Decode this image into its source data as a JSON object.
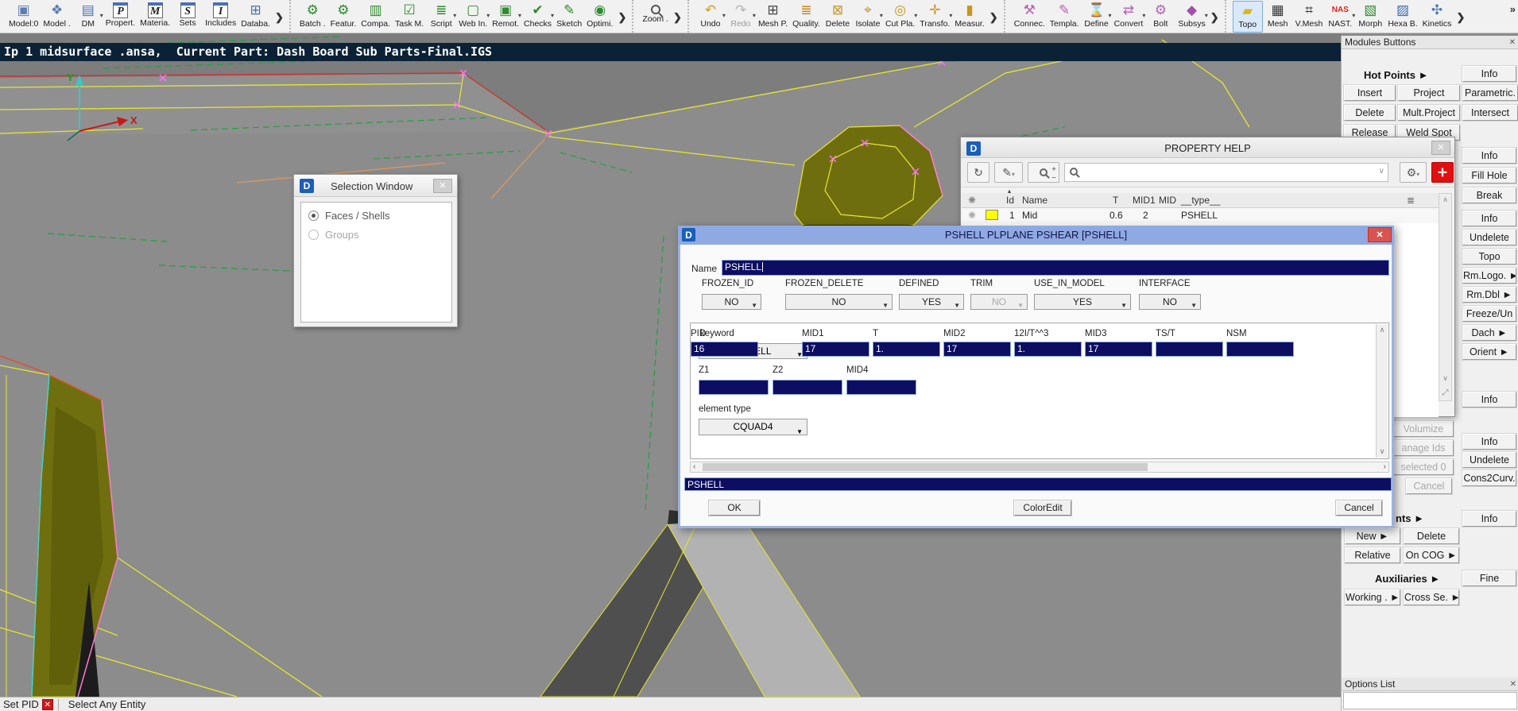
{
  "app": {
    "icon_letter": "D"
  },
  "colors": {
    "dialog_titlebar_blue": "#8fa9e3",
    "navy_field": "#0d0d62",
    "property_swatch_yellow": "#ffff00",
    "topo_active_bg": "#d9e9fb",
    "close_red": "#d9534f",
    "status_red": "#d01818",
    "viewport_gray": "#8a8a8a",
    "infobar_navy": "#0b2236"
  },
  "toolbar": {
    "overflow_chevron": "»",
    "groups": [
      {
        "items": [
          {
            "label": "Model:0",
            "icon": "▣",
            "color": "#5b7db1",
            "name": "model0"
          },
          {
            "label": "Model .",
            "icon": "❖",
            "color": "#5b7db1",
            "name": "model"
          },
          {
            "label": "DM",
            "icon": "▤",
            "color": "#4a6fb5",
            "dd": "▾",
            "name": "dm"
          },
          {
            "label": "Propert.",
            "icon": "P",
            "cls": "letter",
            "name": "properties"
          },
          {
            "label": "Materia.",
            "icon": "M",
            "cls": "letter",
            "name": "materials"
          },
          {
            "label": "Sets",
            "icon": "S",
            "cls": "letter",
            "name": "sets"
          },
          {
            "label": "Includes",
            "icon": "I",
            "cls": "letter",
            "name": "includes"
          },
          {
            "label": "Databa.",
            "icon": "⊞",
            "color": "#4a6fb5",
            "name": "database"
          },
          {
            "label": "",
            "icon": "❯",
            "cls": "chev",
            "name": "group-overflow"
          }
        ]
      },
      {
        "items": [
          {
            "label": "Batch .",
            "icon": "⚙",
            "color": "#2e8b2e",
            "name": "batch"
          },
          {
            "label": "Featur.",
            "icon": "⚙",
            "color": "#2e8b2e",
            "name": "features"
          },
          {
            "label": "Compa.",
            "icon": "▥",
            "color": "#2e8b2e",
            "name": "compare"
          },
          {
            "label": "Task M.",
            "icon": "☑",
            "color": "#2e8b2e",
            "name": "task-manager"
          },
          {
            "label": "Script",
            "icon": "≣",
            "color": "#2e8b2e",
            "dd": "▾",
            "name": "script"
          },
          {
            "label": "Web In.",
            "icon": "▢",
            "color": "#2e8b2e",
            "dd": "▾",
            "name": "web-info"
          },
          {
            "label": "Remot.",
            "icon": "▣",
            "color": "#2e8b2e",
            "dd": "▾",
            "name": "remote"
          },
          {
            "label": "Checks",
            "icon": "✔",
            "color": "#2e8b2e",
            "dd": "▾",
            "name": "checks"
          },
          {
            "label": "Sketch",
            "icon": "✎",
            "color": "#2e8b2e",
            "name": "sketch"
          },
          {
            "label": "Optimi.",
            "icon": "◉",
            "color": "#2e8b2e",
            "name": "optimization"
          },
          {
            "label": "",
            "icon": "❯",
            "cls": "chev",
            "name": "group-overflow"
          }
        ]
      },
      {
        "items": [
          {
            "label": "Zoom .",
            "icon": "",
            "cls": "magcss",
            "name": "zoom"
          },
          {
            "label": "",
            "icon": "❯",
            "cls": "chev",
            "name": "group-overflow"
          }
        ]
      },
      {
        "items": [
          {
            "label": "Undo",
            "icon": "↶",
            "color": "#d4a017",
            "dd": "▾",
            "name": "undo"
          },
          {
            "label": "Redo",
            "icon": "↷",
            "color": "#b5b5b5",
            "dd": "▾",
            "cls": "disabled",
            "name": "redo"
          },
          {
            "label": "Mesh P.",
            "icon": "⊞",
            "color": "#444444",
            "name": "mesh-parameters"
          },
          {
            "label": "Quality.",
            "icon": "≣",
            "color": "#c8861a",
            "name": "quality-criteria"
          },
          {
            "label": "Delete",
            "icon": "⊠",
            "color": "#c8961e",
            "name": "delete"
          },
          {
            "label": "Isolate",
            "icon": "⌖",
            "color": "#c8961e",
            "dd": "▾",
            "name": "isolate"
          },
          {
            "label": "Cut Pla.",
            "icon": "◎",
            "color": "#c8961e",
            "dd": "▾",
            "name": "cut-plane"
          },
          {
            "label": "Transfo.",
            "icon": "✛",
            "color": "#c8961e",
            "dd": "▾",
            "name": "transform"
          },
          {
            "label": "Measur.",
            "icon": "▮",
            "color": "#c8961e",
            "name": "measure"
          },
          {
            "label": "",
            "icon": "❯",
            "cls": "chev",
            "name": "group-overflow"
          }
        ]
      },
      {
        "items": [
          {
            "label": "Connec.",
            "icon": "⚒",
            "color": "#b565b5",
            "name": "connections"
          },
          {
            "label": "Templa.",
            "icon": "✎",
            "color": "#b565b5",
            "name": "templates"
          },
          {
            "label": "Define",
            "icon": "⌛",
            "color": "#b565b5",
            "dd": "▾",
            "name": "define"
          },
          {
            "label": "Convert",
            "icon": "⇄",
            "color": "#b565b5",
            "dd": "▾",
            "name": "convert"
          },
          {
            "label": "Bolt",
            "icon": "⚙",
            "color": "#b565b5",
            "name": "bolt"
          },
          {
            "label": "Subsys",
            "icon": "◆",
            "color": "#a050a8",
            "dd": "▾",
            "name": "subsystems"
          },
          {
            "label": "",
            "icon": "❯",
            "cls": "chev",
            "name": "group-overflow"
          }
        ]
      },
      {
        "items": [
          {
            "label": "Topo",
            "icon": "▰",
            "color": "#d8b81c",
            "cls": "active",
            "name": "topo"
          },
          {
            "label": "Mesh",
            "icon": "▦",
            "color": "#333333",
            "name": "mesh"
          },
          {
            "label": "V.Mesh",
            "icon": "⌗",
            "color": "#333333",
            "name": "volume-mesh"
          },
          {
            "label": "NAST.",
            "icon": "NAS",
            "color": "#e02020",
            "cls": "nas",
            "dd": "▾",
            "name": "nastran"
          },
          {
            "label": "Morph",
            "icon": "▧",
            "color": "#2e8b2e",
            "name": "morph"
          },
          {
            "label": "Hexa B.",
            "icon": "▨",
            "color": "#3a6ab5",
            "name": "hexa-block"
          },
          {
            "label": "Kinetics",
            "icon": "✣",
            "color": "#4a7ab5",
            "name": "kinetics"
          },
          {
            "label": "",
            "icon": "❯",
            "cls": "chev",
            "name": "group-overflow"
          }
        ]
      }
    ]
  },
  "viewport": {
    "info_text": "Ip 1 midsurface .ansa,  Current Part: Dash Board Sub Parts-Final.IGS",
    "axis_x": "X",
    "axis_y": "Y"
  },
  "selection_window": {
    "title": "Selection Window",
    "close": "✕",
    "options": [
      {
        "label": "Faces / Shells",
        "cls": "sel"
      },
      {
        "label": "Groups",
        "cls": "dim"
      }
    ]
  },
  "property_help": {
    "title": "PROPERTY HELP",
    "close": "✕",
    "sort_marker": "▴",
    "columns": [
      {
        "label": "Id"
      },
      {
        "label": "Name"
      },
      {
        "label": "T"
      },
      {
        "label": "MID1"
      },
      {
        "label": "MID"
      },
      {
        "label": "__type__"
      }
    ],
    "row": {
      "id": "1",
      "name": "Mid",
      "t": "0.6",
      "mid1": "2",
      "mid": "",
      "type": "PSHELL",
      "swatch_style": "background:#ffff00"
    },
    "tools": {
      "refresh": "↻",
      "edit": "✎",
      "zoom_plus": "+",
      "zoom_minus": "−",
      "search_arrow": "∨",
      "gear": "⚙",
      "picker": "✛",
      "columns_icon": "≣",
      "scroll_up": "∧",
      "scroll_down": "∨",
      "expand": "⤢"
    }
  },
  "pshell_dialog": {
    "title": "PSHELL PLPLANE PSHEAR [PSHELL]",
    "close": "✕",
    "name_label": "Name",
    "name_value": "PSHELL",
    "flags": [
      {
        "label": "FROZEN_ID",
        "value": "NO"
      },
      {
        "label": "FROZEN_DELETE",
        "value": "NO"
      },
      {
        "label": "DEFINED",
        "value": "YES"
      },
      {
        "label": "TRIM",
        "value": "NO",
        "cls": "disabled"
      },
      {
        "label": "USE_IN_MODEL",
        "value": "YES"
      },
      {
        "label": "INTERFACE",
        "value": "NO"
      }
    ],
    "keyword_label": "keyword",
    "keyword_value": "PSHELL",
    "columns": [
      {
        "label": "PID",
        "value": "16"
      },
      {
        "label": "MID1",
        "value": "17"
      },
      {
        "label": "T",
        "value": "1."
      },
      {
        "label": "MID2",
        "value": "17"
      },
      {
        "label": "12I/T^^3",
        "value": "1."
      },
      {
        "label": "MID3",
        "value": "17"
      },
      {
        "label": "TS/T",
        "value": ""
      },
      {
        "label": "NSM",
        "value": ""
      }
    ],
    "z_fields": [
      {
        "label": "Z1",
        "value": ""
      },
      {
        "label": "Z2",
        "value": ""
      },
      {
        "label": "MID4",
        "value": ""
      }
    ],
    "element_type_label": "element type",
    "element_type_value": "CQUAD4",
    "status_value": "PSHELL",
    "ok": "OK",
    "coloredit": "ColorEdit",
    "cancel": "Cancel",
    "scroll": {
      "up": "∧",
      "down": "∨",
      "left": "‹",
      "right": "›"
    }
  },
  "right_panel": {
    "modules_header": "Modules Buttons",
    "close": "✕",
    "hot_points_label": "Hot Points ►",
    "info_top": "Info",
    "hot_rows": [
      [
        "Insert",
        "Project",
        "Parametric."
      ],
      [
        "Delete",
        "Mult.Project",
        "Intersect"
      ],
      [
        "Release",
        "Weld Spot"
      ]
    ],
    "stack_a": [
      "Info",
      "Fill Hole",
      "Break"
    ],
    "stack_b": [
      "Info",
      "Undelete",
      "Topo",
      "Rm.Logo. ►",
      "Rm.Dbl ►",
      "Freeze/Un",
      "Dach ►",
      "Orient ►"
    ],
    "stack_c": [
      "Info"
    ],
    "stack_d": [
      "Info",
      "Undelete",
      "Cons2Curv."
    ],
    "stack_e": [
      "Info"
    ],
    "gray_stack": [
      "Volumize",
      "anage Ids",
      "selected 0",
      "Cancel"
    ],
    "points_label": "nts ►",
    "points_rows": [
      [
        "New ►",
        "Delete"
      ],
      [
        "Relative",
        "On COG ►"
      ]
    ],
    "aux_label": "Auxiliaries ►",
    "fine": "Fine",
    "aux_rows": [
      [
        "Working . ►",
        "Cross Se. ►"
      ]
    ],
    "options_header": "Options List"
  },
  "status_bar": {
    "mode": "Set PID",
    "hint": "Select Any Entity"
  }
}
